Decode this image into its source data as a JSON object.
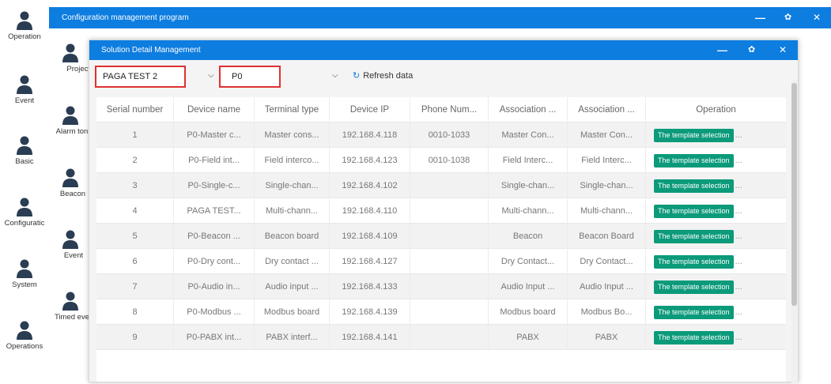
{
  "sidebar": {
    "items": [
      {
        "label": "Operation"
      },
      {
        "label": "Event"
      },
      {
        "label": "Basic"
      },
      {
        "label": "Configuratic"
      },
      {
        "label": "System"
      },
      {
        "label": "Operations"
      }
    ]
  },
  "back_window": {
    "title": "Configuration management program",
    "controls": {
      "minimize": "—",
      "restore": "✿",
      "close": "✕"
    },
    "column": [
      {
        "label": "Project"
      },
      {
        "label": "Alarm ton"
      },
      {
        "label": "Beacon"
      },
      {
        "label": "Event"
      },
      {
        "label": "Timed eve"
      }
    ]
  },
  "dialog": {
    "title": "Solution Detail Management",
    "controls": {
      "minimize": "—",
      "restore": "✿",
      "close": "✕"
    },
    "project_select": "PAGA TEST 2",
    "level_select": "P0",
    "refresh_label": "Refresh data",
    "table": {
      "headers": [
        "Serial number",
        "Device name",
        "Terminal type",
        "Device IP",
        "Phone Num...",
        "Association ...",
        "Association ...",
        "Operation"
      ],
      "rows": [
        [
          "1",
          "P0-Master c...",
          "Master cons...",
          "192.168.4.118",
          "0010-1033",
          "Master Con...",
          "Master Con..."
        ],
        [
          "2",
          "P0-Field int...",
          "Field interco...",
          "192.168.4.123",
          "0010-1038",
          "Field Interc...",
          "Field Interc..."
        ],
        [
          "3",
          "P0-Single-c...",
          "Single-chan...",
          "192.168.4.102",
          "",
          "Single-chan...",
          "Single-chan..."
        ],
        [
          "4",
          "PAGA TEST...",
          "Multi-chann...",
          "192.168.4.110",
          "",
          "Multi-chann...",
          "Multi-chann..."
        ],
        [
          "5",
          "P0-Beacon ...",
          "Beacon board",
          "192.168.4.109",
          "",
          "Beacon",
          "Beacon Board"
        ],
        [
          "6",
          "P0-Dry cont...",
          "Dry contact ...",
          "192.168.4.127",
          "",
          "Dry Contact...",
          "Dry Contact..."
        ],
        [
          "7",
          "P0-Audio in...",
          "Audio input ...",
          "192.168.4.133",
          "",
          "Audio Input ...",
          "Audio Input ..."
        ],
        [
          "8",
          "P0-Modbus ...",
          "Modbus board",
          "192.168.4.139",
          "",
          "Modbus board",
          "Modbus Bo..."
        ],
        [
          "9",
          "P0-PABX int...",
          "PABX interf...",
          "192.168.4.141",
          "",
          "PABX",
          "PABX"
        ]
      ],
      "operation_button": "The template selection",
      "operation_more": "..."
    }
  },
  "colors": {
    "title_bar": "#0d7de0",
    "button": "#0b9a7a",
    "highlight_box": "#e03030",
    "icon": "#2a3d52"
  }
}
